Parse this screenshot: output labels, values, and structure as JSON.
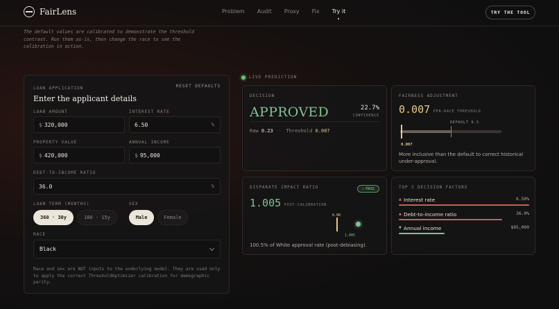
{
  "nav": {
    "brand": "FairLens",
    "links": [
      "Problem",
      "Audit",
      "Proxy",
      "Fix",
      "Try it"
    ],
    "active_link": "Try it",
    "cta": "TRY THE TOOL"
  },
  "intro": "The default values are calibrated to demonstrate the threshold contrast. Run them as-is, then change the race to see the calibration in action.",
  "application": {
    "eyebrow": "LOAN APPLICATION",
    "reset_label": "RESET DEFAULTS",
    "title": "Enter the applicant details",
    "loan_amount": {
      "label": "LOAN AMOUNT",
      "prefix": "$",
      "value": "320,000"
    },
    "interest_rate": {
      "label": "INTEREST RATE",
      "value": "6.50",
      "suffix": "%"
    },
    "property_value": {
      "label": "PROPERTY VALUE",
      "prefix": "$",
      "value": "420,000"
    },
    "annual_income": {
      "label": "ANNUAL INCOME",
      "prefix": "$",
      "value": "95,000"
    },
    "dti": {
      "label": "DEBT-TO-INCOME RATIO",
      "value": "36.0",
      "suffix": "%"
    },
    "loan_term": {
      "label": "LOAN TERM (MONTHS)",
      "options": [
        "360 · 30y",
        "180 · 15y"
      ],
      "selected": "360 · 30y"
    },
    "sex": {
      "label": "SEX",
      "options": [
        "Male",
        "Female"
      ],
      "selected": "Male"
    },
    "race": {
      "label": "RACE",
      "value": "Black"
    },
    "note": "Race and sex are NOT inputs to the underlying model. They are used only to apply the correct ThresholdOptimizer calibration for demographic parity."
  },
  "live": {
    "label": "LIVE PREDICTION",
    "color": "#6fbf73"
  },
  "decision": {
    "eyebrow": "DECISION",
    "result": "APPROVED",
    "confidence": "22.7%",
    "confidence_label": "CONFIDENCE",
    "raw_label": "Raw",
    "raw_value": "0.23",
    "threshold_label": "Threshold",
    "threshold_value": "0.007",
    "color": "#7fc492"
  },
  "fairness": {
    "eyebrow": "FAIRNESS ADJUSTMENT",
    "value": "0.007",
    "value_label": "PER-RACE THRESHOLD",
    "default_label": "DEFAULT 0.5",
    "default_value": 0.5,
    "current_value": 0.007,
    "marker_label": "0.007",
    "description": "More inclusive than the default to correct historical under-approval."
  },
  "impact": {
    "eyebrow": "DISPARATE IMPACT RATIO",
    "badge": "PASS",
    "value": "1.005",
    "value_label": "POST-CALIBRATION",
    "gauge_top_label": "0.80",
    "gauge_bottom_label": "1.005",
    "description": "100.5% of White approval rate (post-debiasing)."
  },
  "factors": {
    "eyebrow": "TOP 3 DECISION FACTORS",
    "items": [
      {
        "name": "Interest rate",
        "value": "6.50%",
        "direction": "up",
        "weight": 1.0,
        "color": "#c9614f"
      },
      {
        "name": "Debt-to-income ratio",
        "value": "36.0%",
        "direction": "up",
        "weight": 0.79,
        "color": "#c9614f"
      },
      {
        "name": "Annual income",
        "value": "$95,000",
        "direction": "down",
        "weight": 0.35,
        "color": "#7fc492"
      }
    ]
  }
}
